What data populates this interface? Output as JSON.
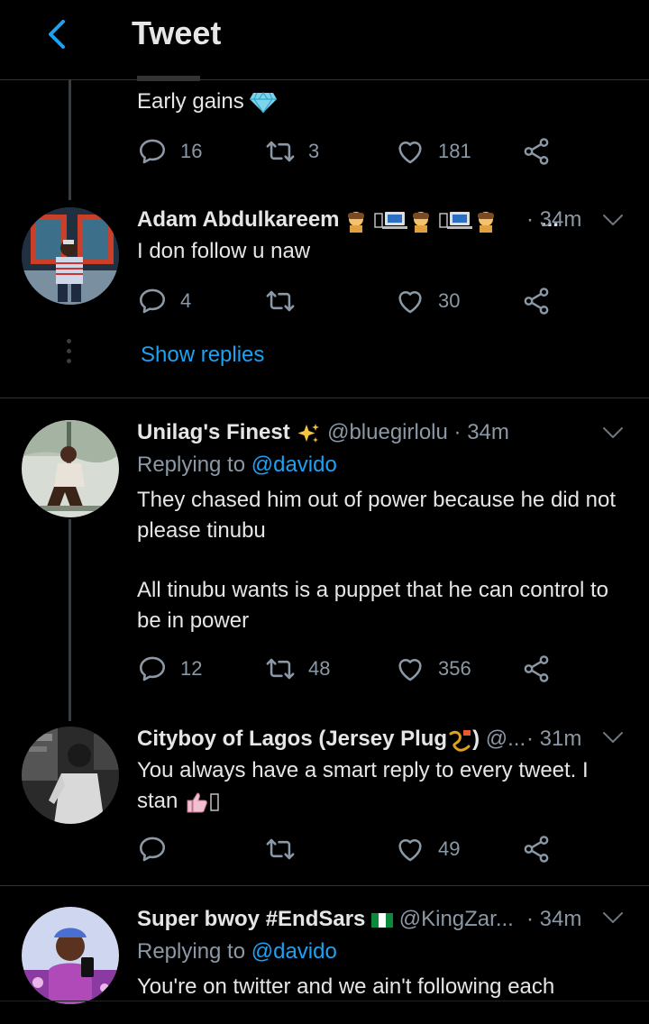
{
  "header": {
    "title": "Tweet"
  },
  "tweets": [
    {
      "text": "Early gains",
      "reply_count": "16",
      "retweet_count": "3",
      "like_count": "181"
    },
    {
      "name": "Adam Abdulkareem",
      "name_suffix": "...",
      "time": "· 34m",
      "text": "I don follow u naw",
      "reply_count": "4",
      "retweet_count": "",
      "like_count": "30"
    },
    {
      "name": "Unilag's Finest",
      "handle": "@bluegirlolu",
      "time": "· 34m",
      "replying_label": "Replying to",
      "replying_handle": "@davido",
      "text_p1": "They chased him out of power because he did not please tinubu",
      "text_p2": "All tinubu wants is a puppet that he can control to be in power",
      "reply_count": "12",
      "retweet_count": "48",
      "like_count": "356"
    },
    {
      "name": "Cityboy of Lagos (Jersey Plug",
      "name_close": ")",
      "handle": "@...",
      "time": "· 31m",
      "text": "You always have a smart reply to every tweet. I stan",
      "reply_count": "",
      "retweet_count": "",
      "like_count": "49"
    },
    {
      "name": "Super bwoy #EndSars",
      "handle": "@KingZar...",
      "time": "· 34m",
      "replying_label": "Replying to",
      "replying_handle": "@davido",
      "text": "You're on twitter and we ain't following each"
    }
  ],
  "show_replies": "Show replies",
  "colors": {
    "accent": "#1da1f2",
    "secondary": "#8b98a5",
    "background": "#000000"
  },
  "icons": [
    "back-arrow-icon",
    "diamond-icon",
    "reply-icon",
    "retweet-icon",
    "like-icon",
    "share-icon",
    "sparkles-icon",
    "chevron-down-icon",
    "nigeria-flag-icon"
  ]
}
